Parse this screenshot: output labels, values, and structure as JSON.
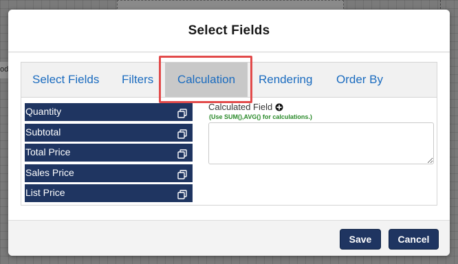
{
  "background": {
    "fragment_text": "od"
  },
  "modal": {
    "title": "Select Fields"
  },
  "tabs": [
    {
      "label": "Select Fields",
      "active": false
    },
    {
      "label": "Filters",
      "active": false
    },
    {
      "label": "Calculation",
      "active": true
    },
    {
      "label": "Rendering",
      "active": false
    },
    {
      "label": "Order By",
      "active": false
    }
  ],
  "fields": [
    {
      "label": "Quantity"
    },
    {
      "label": "Subtotal"
    },
    {
      "label": "Total Price"
    },
    {
      "label": "Sales Price"
    },
    {
      "label": "List Price"
    }
  ],
  "calculation": {
    "label": "Calculated Field",
    "hint": "(Use SUM(),AVG() for calculations.)",
    "value": ""
  },
  "footer": {
    "save_label": "Save",
    "cancel_label": "Cancel"
  },
  "colors": {
    "accent": "#1f3561",
    "tab_text": "#1a6bbf",
    "highlight": "#e24a4a",
    "hint": "#2a8a2a"
  },
  "icons": {
    "field_copy": "copy-icon",
    "add": "plus-circle-icon"
  }
}
